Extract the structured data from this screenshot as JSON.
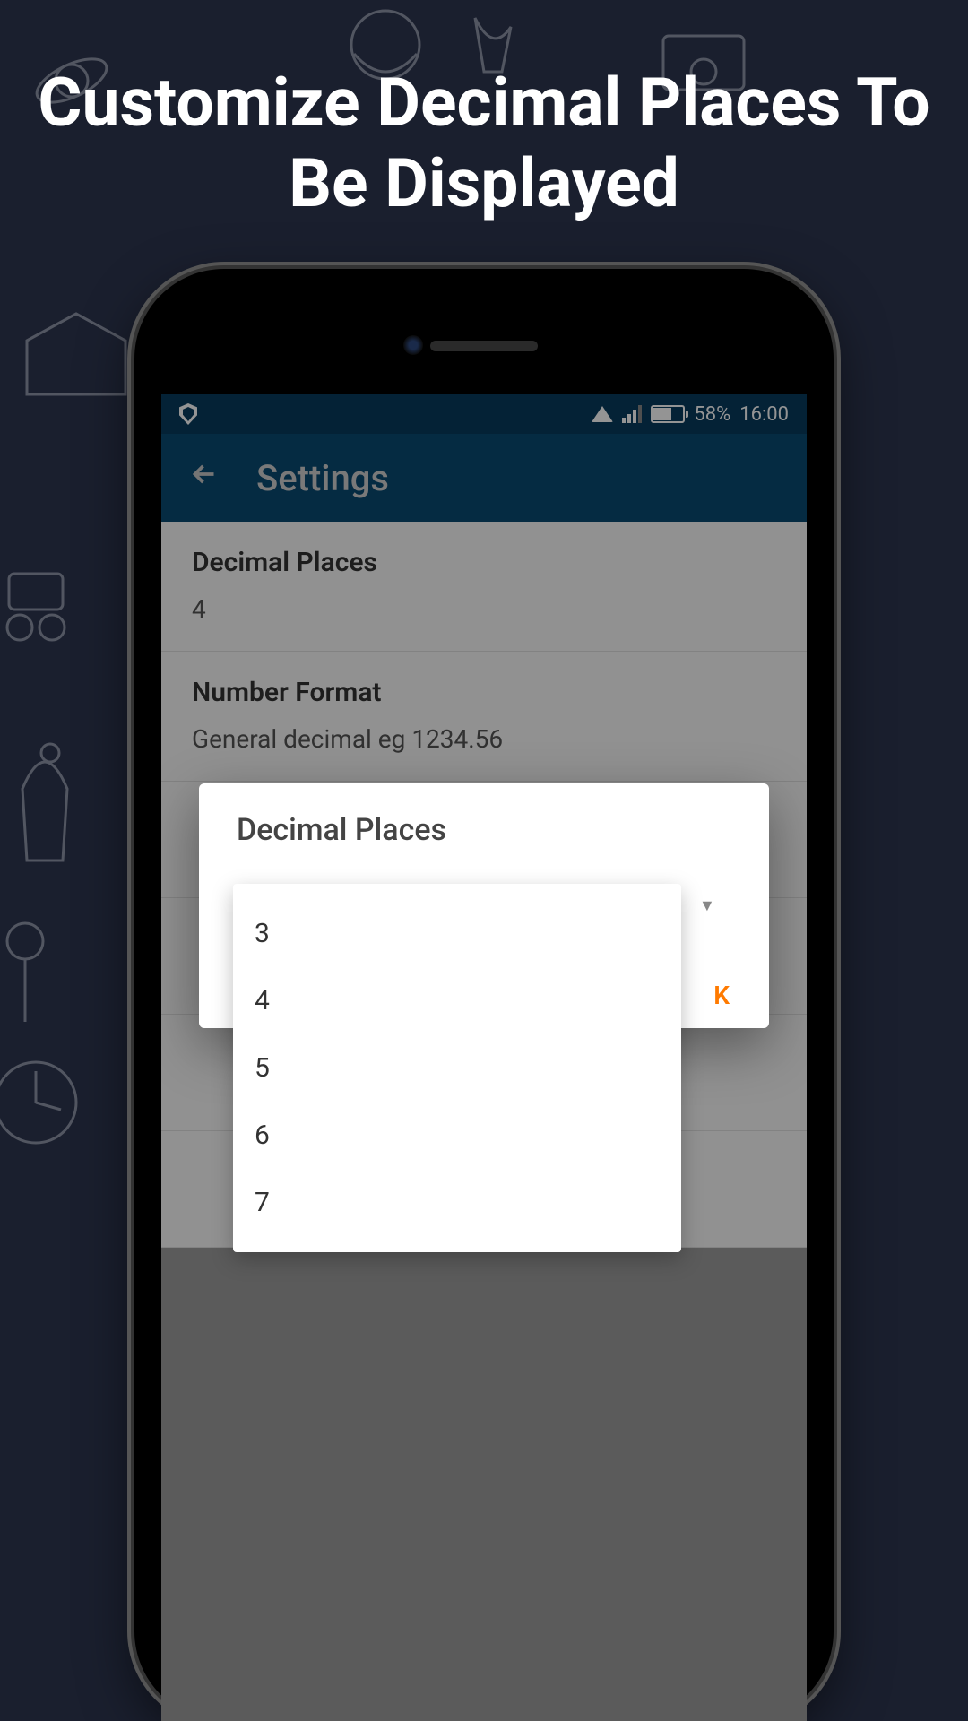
{
  "promo_headline": "Customize Decimal Places To Be Displayed",
  "status_bar": {
    "battery_percent": "58%",
    "time": "16:00"
  },
  "app_bar": {
    "title": "Settings"
  },
  "settings": [
    {
      "title": "Decimal Places",
      "value": "4"
    },
    {
      "title": "Number Format",
      "value": "General decimal   eg 1234.56"
    }
  ],
  "dialog": {
    "title": "Decimal Places",
    "ok_label": "K",
    "options": [
      "3",
      "4",
      "5",
      "6",
      "7"
    ]
  }
}
